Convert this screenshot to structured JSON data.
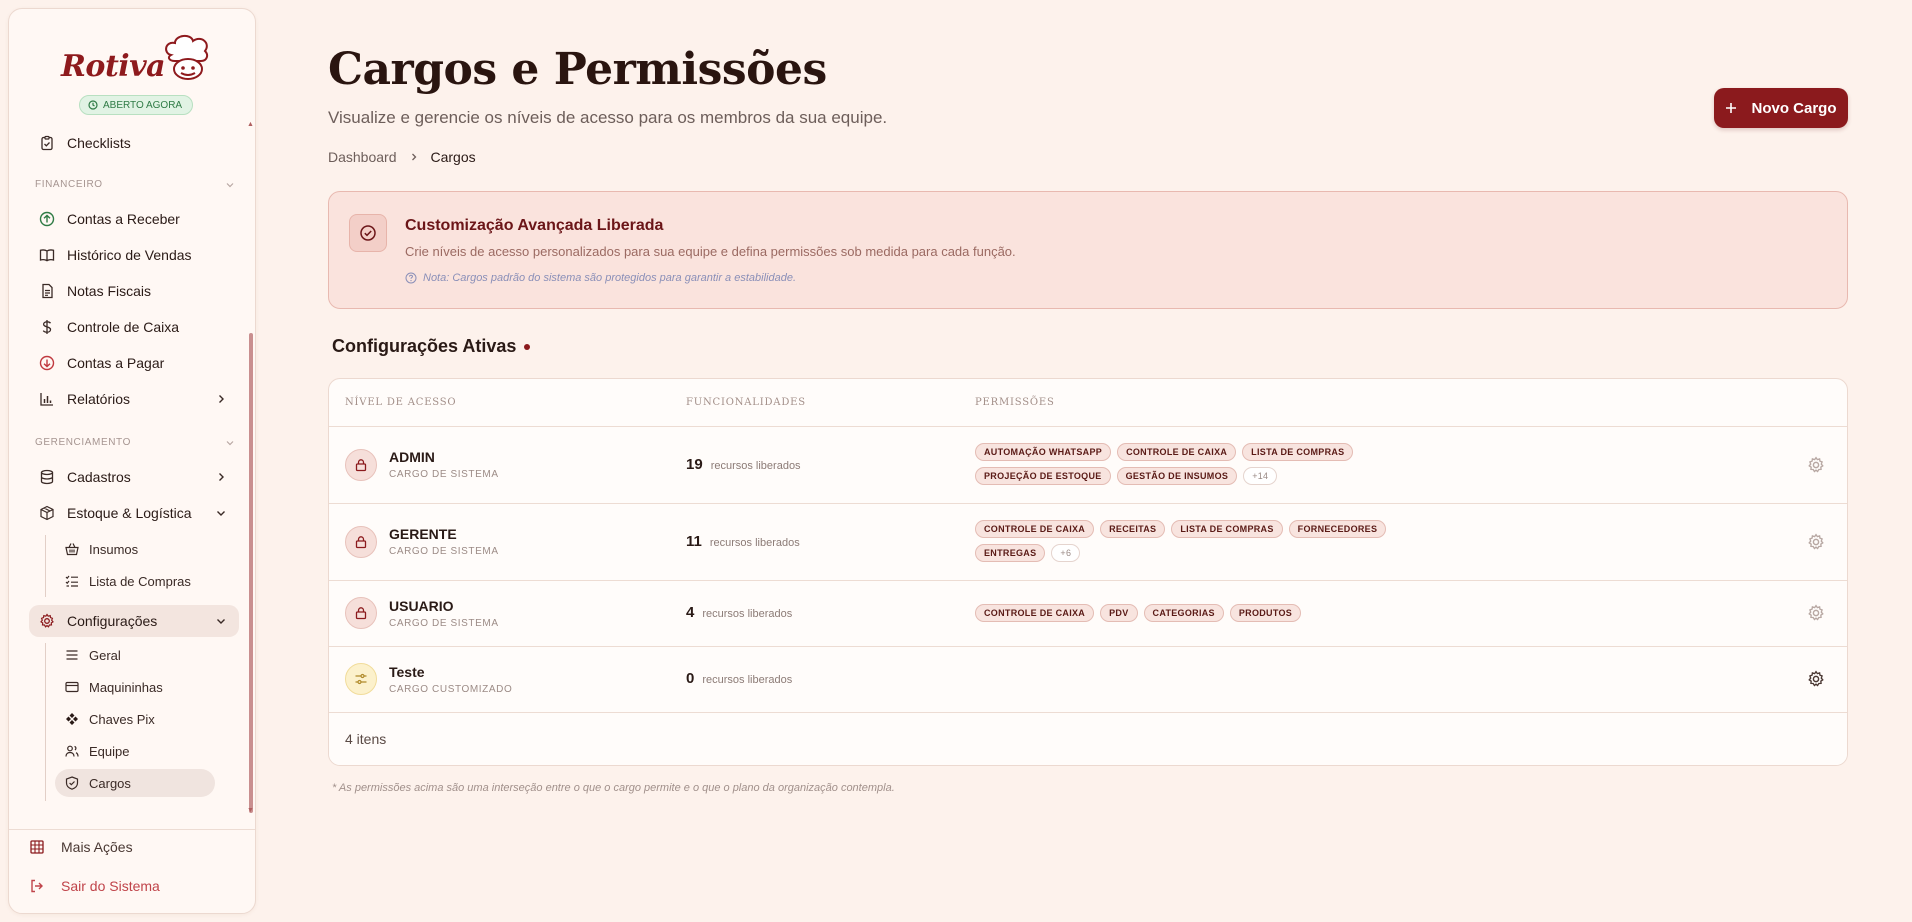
{
  "app": {
    "logo_text": "Rotiva",
    "status_badge": "ABERTO AGORA"
  },
  "sidebar": {
    "top_item": "Checklists",
    "sections": {
      "financeiro": "FINANCEIRO",
      "gerenciamento": "GERENCIAMENTO"
    },
    "financeiro_items": [
      "Contas a Receber",
      "Histórico de Vendas",
      "Notas Fiscais",
      "Controle de Caixa",
      "Contas a Pagar",
      "Relatórios"
    ],
    "gerenciamento_items": [
      "Cadastros",
      "Estoque & Logística"
    ],
    "estoque_sub": [
      "Insumos",
      "Lista de Compras"
    ],
    "config_label": "Configurações",
    "config_sub": [
      "Geral",
      "Maquininhas",
      "Chaves Pix",
      "Equipe",
      "Cargos"
    ],
    "bottom": {
      "more": "Mais Ações",
      "logout": "Sair do Sistema"
    }
  },
  "header": {
    "title": "Cargos e Permissões",
    "subtitle": "Visualize e gerencie os níveis de acesso para os membros da sua equipe.",
    "breadcrumb": [
      "Dashboard",
      "Cargos"
    ],
    "new_button": "Novo Cargo"
  },
  "banner": {
    "title": "Customização Avançada Liberada",
    "text": "Crie níveis de acesso personalizados para sua equipe e defina permissões sob medida para cada função.",
    "note": "Nota: Cargos padrão do sistema são protegidos para garantir a estabilidade."
  },
  "section_title": "Configurações Ativas",
  "table": {
    "headers": [
      "NÍVEL DE ACESSO",
      "FUNCIONALIDADES",
      "PERMISSÕES"
    ],
    "count_label": "recursos liberados",
    "rows": [
      {
        "name": "ADMIN",
        "type": "CARGO DE SISTEMA",
        "count": "19",
        "chips": [
          "AUTOMAÇÃO WHATSAPP",
          "CONTROLE DE CAIXA",
          "LISTA DE COMPRAS",
          "PROJEÇÃO DE ESTOQUE",
          "GESTÃO DE INSUMOS"
        ],
        "more": "+14"
      },
      {
        "name": "GERENTE",
        "type": "CARGO DE SISTEMA",
        "count": "11",
        "chips": [
          "CONTROLE DE CAIXA",
          "RECEITAS",
          "LISTA DE COMPRAS",
          "FORNECEDORES",
          "ENTREGAS"
        ],
        "more": "+6"
      },
      {
        "name": "USUARIO",
        "type": "CARGO DE SISTEMA",
        "count": "4",
        "chips": [
          "CONTROLE DE CAIXA",
          "PDV",
          "CATEGORIAS",
          "PRODUTOS"
        ],
        "more": ""
      },
      {
        "name": "Teste",
        "type": "CARGO CUSTOMIZADO",
        "count": "0",
        "chips": [],
        "more": ""
      }
    ],
    "total": "4 itens"
  },
  "footnote": "* As permissões acima são uma interseção entre o que o cargo permite e o que o plano da organização contempla.",
  "colors": {
    "brand": "#8b1a1d",
    "background": "#fdf2ec",
    "success": "#2f7b45"
  }
}
